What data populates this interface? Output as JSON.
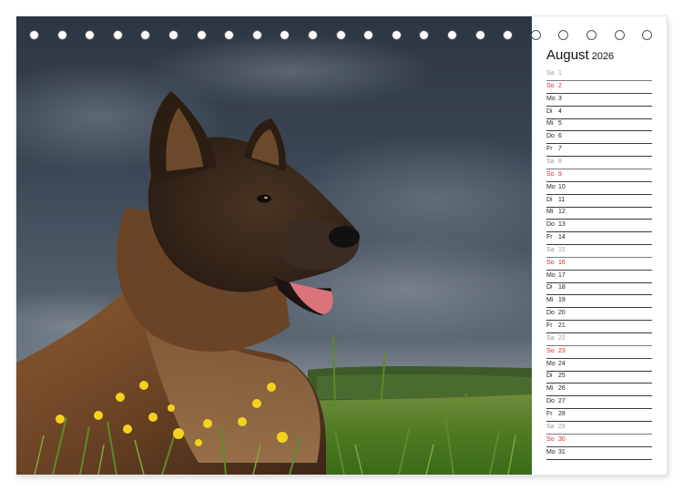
{
  "calendar": {
    "month": "August",
    "year": "2026",
    "days": [
      {
        "dow": "Sa",
        "day": "1",
        "type": "sat"
      },
      {
        "dow": "So",
        "day": "2",
        "type": "sun"
      },
      {
        "dow": "Mo",
        "day": "3",
        "type": "week"
      },
      {
        "dow": "Di",
        "day": "4",
        "type": "week"
      },
      {
        "dow": "Mi",
        "day": "5",
        "type": "week"
      },
      {
        "dow": "Do",
        "day": "6",
        "type": "week"
      },
      {
        "dow": "Fr",
        "day": "7",
        "type": "week"
      },
      {
        "dow": "Sa",
        "day": "8",
        "type": "sat"
      },
      {
        "dow": "So",
        "day": "9",
        "type": "sun"
      },
      {
        "dow": "Mo",
        "day": "10",
        "type": "week"
      },
      {
        "dow": "Di",
        "day": "11",
        "type": "week"
      },
      {
        "dow": "Mi",
        "day": "12",
        "type": "week"
      },
      {
        "dow": "Do",
        "day": "13",
        "type": "week"
      },
      {
        "dow": "Fr",
        "day": "14",
        "type": "week"
      },
      {
        "dow": "Sa",
        "day": "15",
        "type": "sat"
      },
      {
        "dow": "So",
        "day": "16",
        "type": "sun"
      },
      {
        "dow": "Mo",
        "day": "17",
        "type": "week"
      },
      {
        "dow": "Di",
        "day": "18",
        "type": "week"
      },
      {
        "dow": "Mi",
        "day": "19",
        "type": "week"
      },
      {
        "dow": "Do",
        "day": "20",
        "type": "week"
      },
      {
        "dow": "Fr",
        "day": "21",
        "type": "week"
      },
      {
        "dow": "Sa",
        "day": "22",
        "type": "sat"
      },
      {
        "dow": "So",
        "day": "23",
        "type": "sun"
      },
      {
        "dow": "Mo",
        "day": "24",
        "type": "week"
      },
      {
        "dow": "Di",
        "day": "25",
        "type": "week"
      },
      {
        "dow": "Mi",
        "day": "26",
        "type": "week"
      },
      {
        "dow": "Do",
        "day": "27",
        "type": "week"
      },
      {
        "dow": "Fr",
        "day": "28",
        "type": "week"
      },
      {
        "dow": "Sa",
        "day": "29",
        "type": "sat"
      },
      {
        "dow": "So",
        "day": "30",
        "type": "sun"
      },
      {
        "dow": "Mo",
        "day": "31",
        "type": "week"
      }
    ]
  },
  "colors": {
    "saturday": "#9a9a9a",
    "sunday": "#d0312d",
    "weekday": "#222222"
  },
  "photo": {
    "subject": "german-shepherd-dog-in-meadow"
  }
}
